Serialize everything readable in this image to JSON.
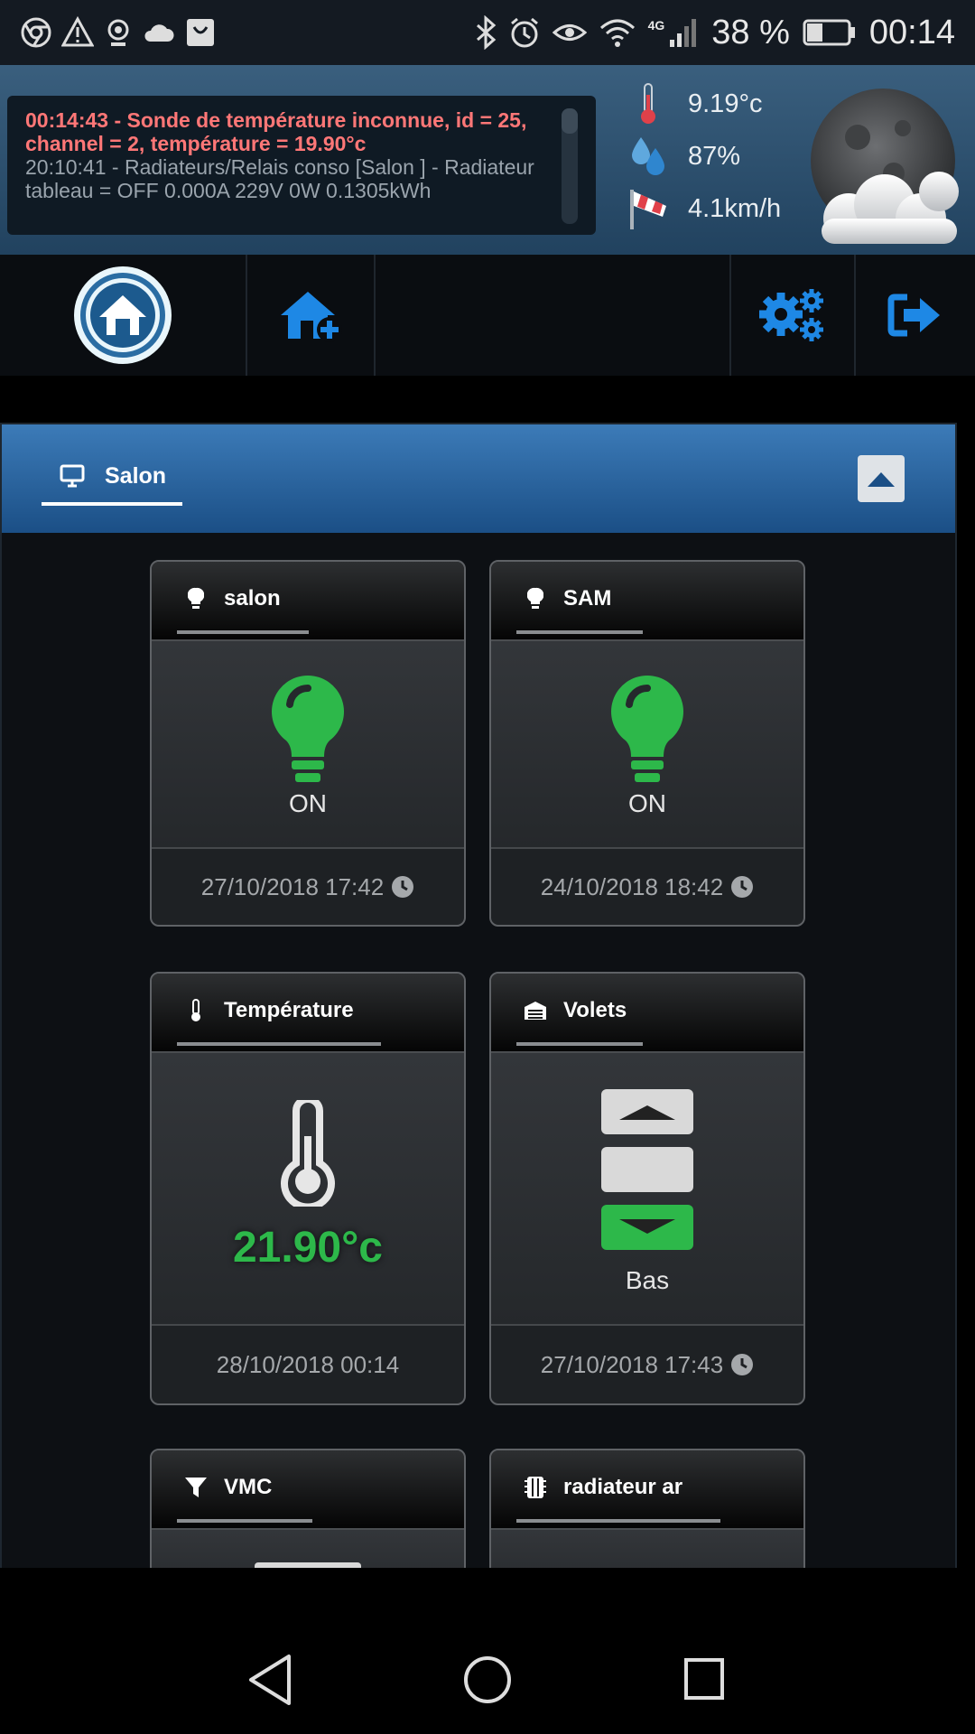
{
  "status_bar": {
    "battery_percent": "38 %",
    "battery_level": 0.38,
    "time": "00:14",
    "network": "4G"
  },
  "log": {
    "line1": "00:14:43 - Sonde de température inconnue, id = 25, channel = 2, température = 19.90°c",
    "line2": "20:10:41 - Radiateurs/Relais conso [Salon ] - Radiateur tableau = OFF 0.000A 229V 0W 0.1305kWh"
  },
  "weather": {
    "temperature": "9.19°c",
    "humidity": "87%",
    "wind": "4.1km/h"
  },
  "nav": {
    "icons": [
      "home-logo-icon",
      "add-home-icon",
      "settings-icon",
      "logout-icon"
    ]
  },
  "room": {
    "name": "Salon"
  },
  "cards": [
    {
      "title": "salon",
      "state": "ON",
      "date": "27/10/2018 17:42",
      "icon": "bulb-icon"
    },
    {
      "title": "SAM",
      "state": "ON",
      "date": "24/10/2018 18:42",
      "icon": "bulb-icon"
    },
    {
      "title": "Température",
      "value": "21.90°c",
      "date": "28/10/2018 00:14",
      "icon": "thermometer-icon"
    },
    {
      "title": "Volets",
      "state": "Bas",
      "date": "27/10/2018 17:43",
      "icon": "shutter-icon"
    },
    {
      "title": "VMC",
      "icon": "filter-icon"
    },
    {
      "title": "radiateur ar",
      "icon": "radiator-icon"
    }
  ],
  "colors": {
    "accent_blue": "#1e88e5",
    "on_green": "#2db84a",
    "log_red": "#ff7777"
  }
}
